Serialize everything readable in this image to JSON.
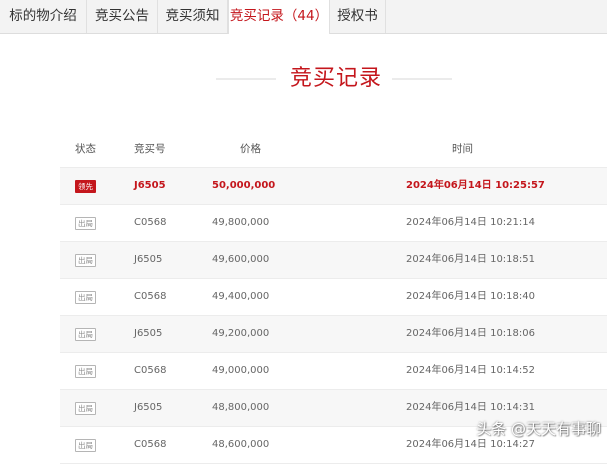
{
  "tabs": [
    {
      "label": "标的物介绍",
      "active": false
    },
    {
      "label": "竞买公告",
      "active": false
    },
    {
      "label": "竞买须知",
      "active": false
    },
    {
      "label": "竞买记录（44）",
      "active": true
    },
    {
      "label": "授权书",
      "active": false
    }
  ],
  "section": {
    "title": "竞买记录"
  },
  "table": {
    "headers": {
      "status": "状态",
      "code": "竞买号",
      "price": "价格",
      "time": "时间"
    },
    "rows": [
      {
        "status": "领先",
        "code": "J6505",
        "price": "50,000,000",
        "time": "2024年06月14日 10:25:57",
        "leading": true
      },
      {
        "status": "出局",
        "code": "C0568",
        "price": "49,800,000",
        "time": "2024年06月14日 10:21:14",
        "leading": false
      },
      {
        "status": "出局",
        "code": "J6505",
        "price": "49,600,000",
        "time": "2024年06月14日 10:18:51",
        "leading": false
      },
      {
        "status": "出局",
        "code": "C0568",
        "price": "49,400,000",
        "time": "2024年06月14日 10:18:40",
        "leading": false
      },
      {
        "status": "出局",
        "code": "J6505",
        "price": "49,200,000",
        "time": "2024年06月14日 10:18:06",
        "leading": false
      },
      {
        "status": "出局",
        "code": "C0568",
        "price": "49,000,000",
        "time": "2024年06月14日 10:14:52",
        "leading": false
      },
      {
        "status": "出局",
        "code": "J6505",
        "price": "48,800,000",
        "time": "2024年06月14日 10:14:31",
        "leading": false
      },
      {
        "status": "出局",
        "code": "C0568",
        "price": "48,600,000",
        "time": "2024年06月14日 10:14:27",
        "leading": false
      }
    ]
  },
  "watermark": "头条 @天天有事聊",
  "colors": {
    "accent": "#c4161c",
    "tabbar_bg": "#f3f3f3",
    "row_alt_bg": "#f7f7f7"
  }
}
